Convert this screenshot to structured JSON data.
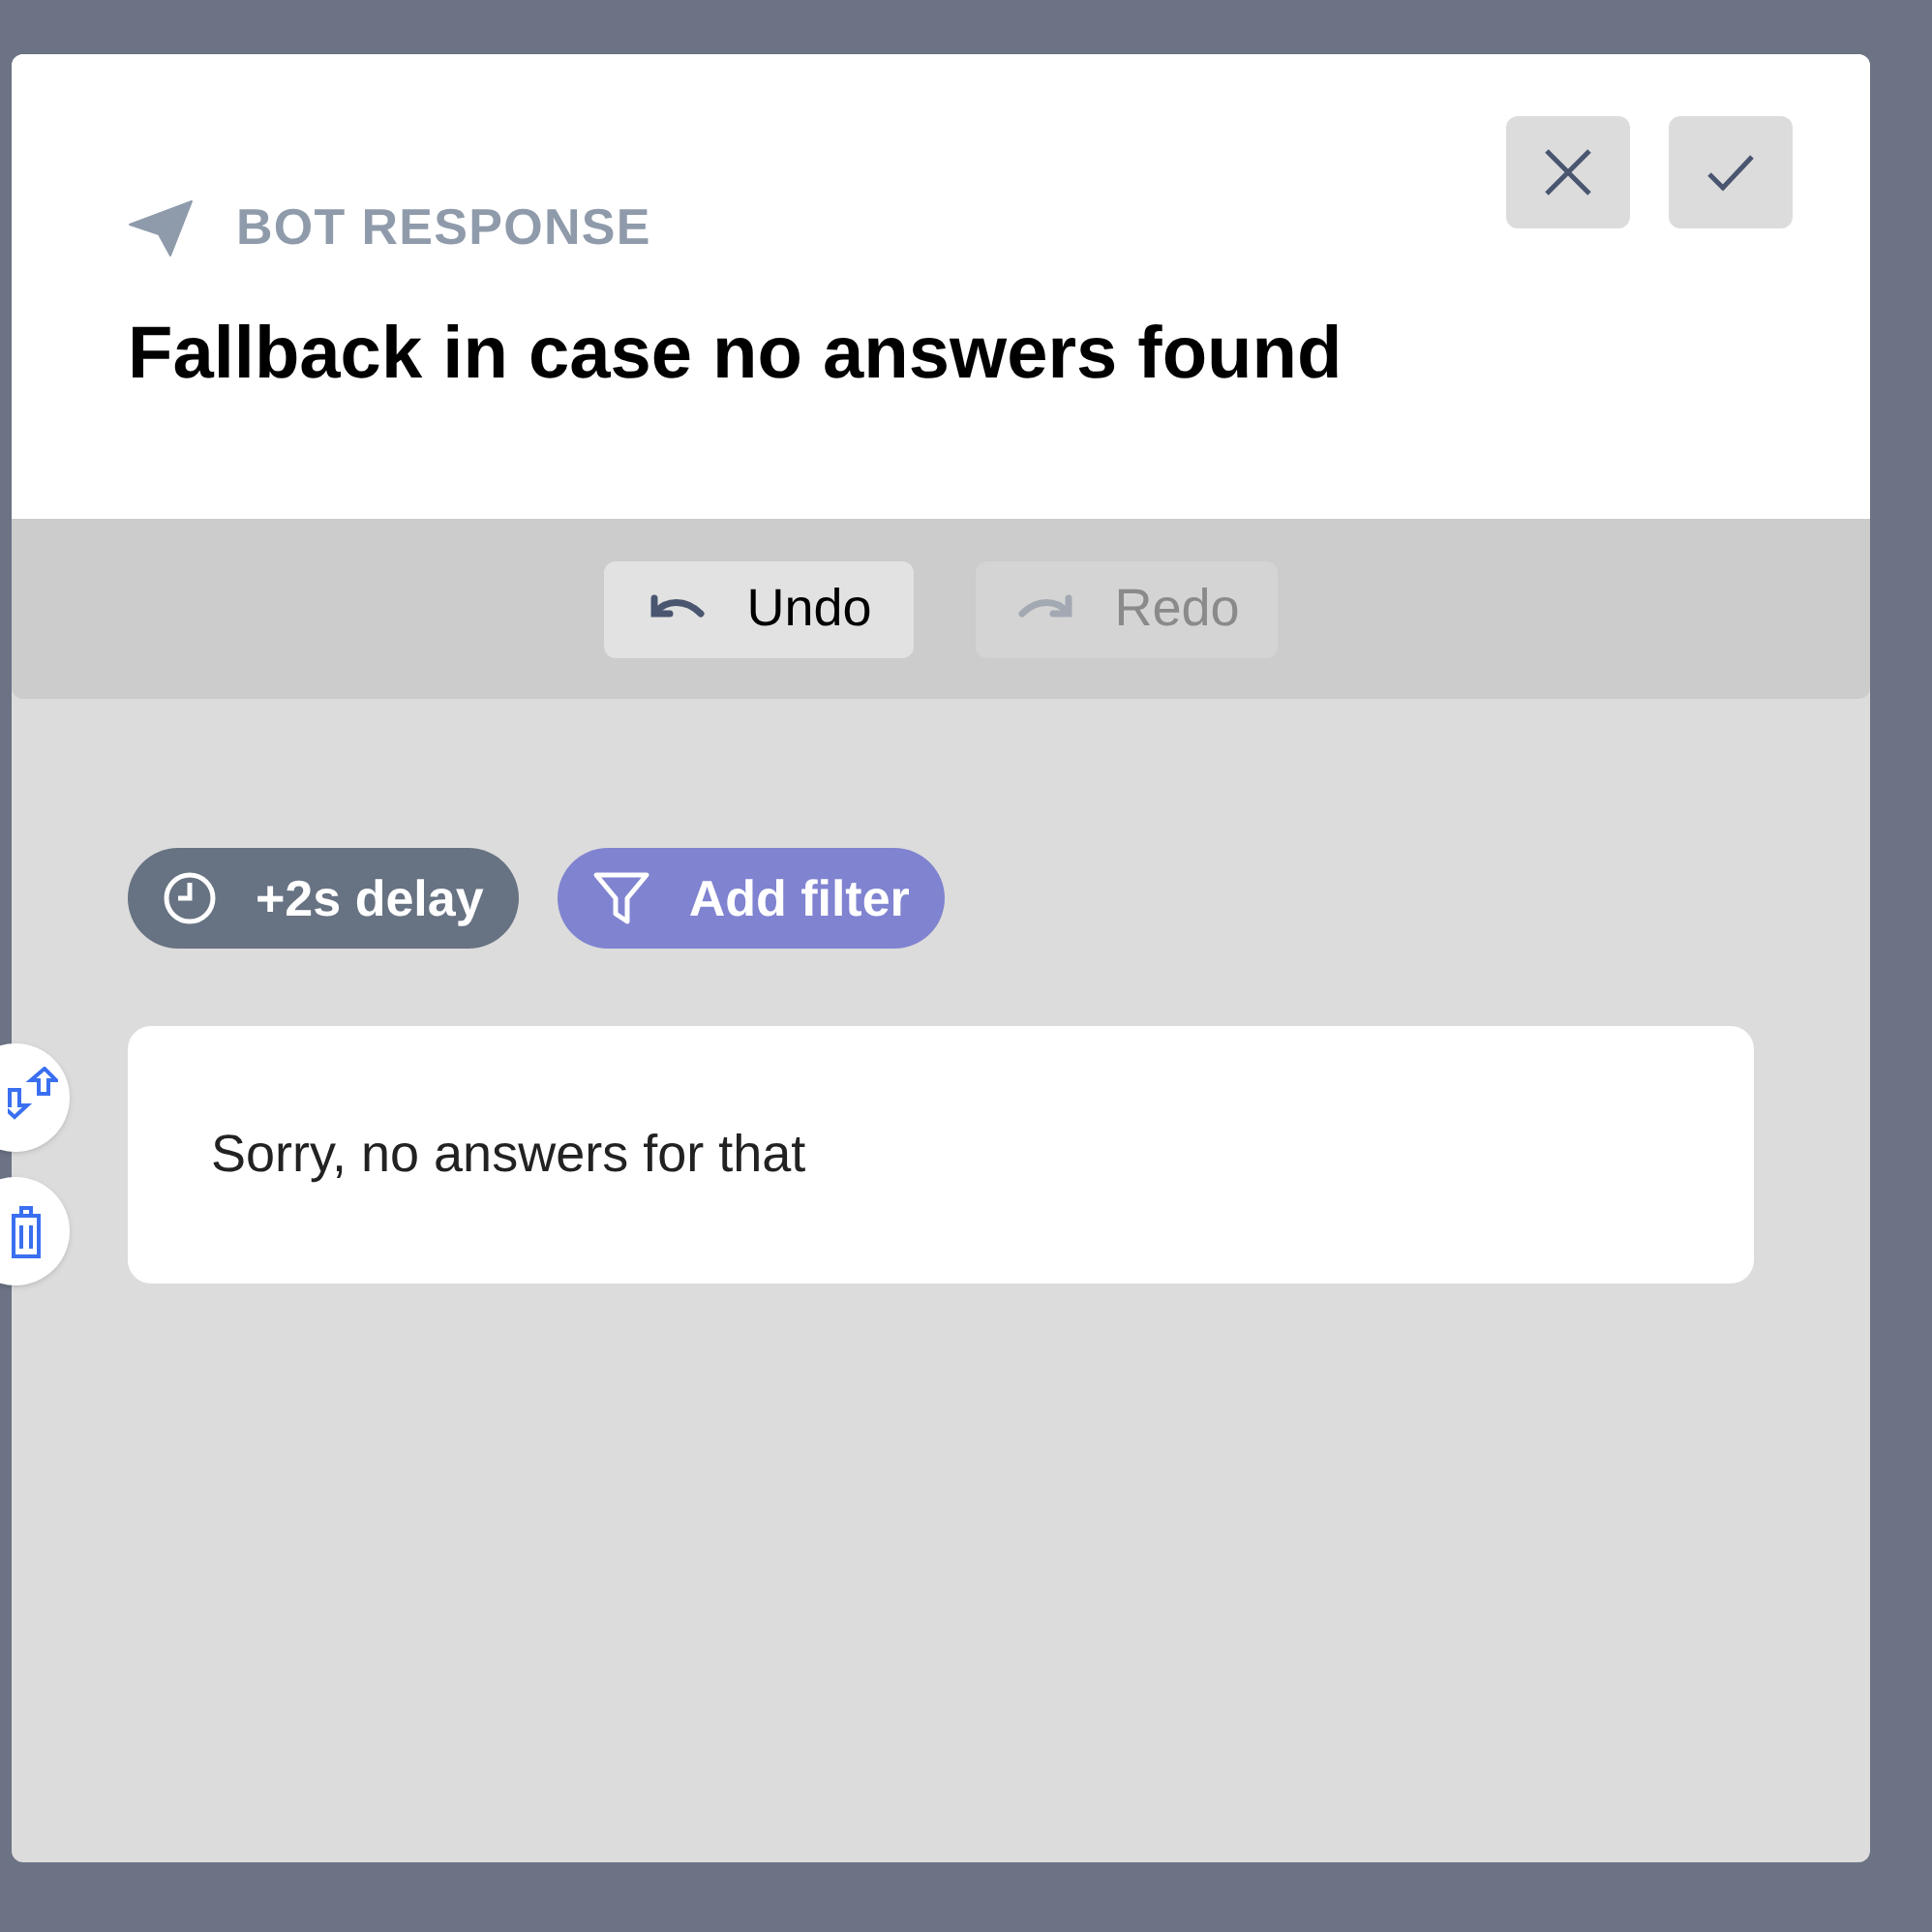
{
  "header": {
    "label": "BOT RESPONSE",
    "title": "Fallback in case no answers found"
  },
  "toolbar": [
    {
      "kind": "undo",
      "label": "Undo",
      "disabled": false
    },
    {
      "kind": "redo",
      "label": "Redo",
      "disabled": true
    }
  ],
  "chips": [
    {
      "kind": "delay",
      "label": "+2s delay"
    },
    {
      "kind": "filter",
      "label": "Add filter"
    }
  ],
  "message": {
    "text": "Sorry, no answers for that"
  }
}
